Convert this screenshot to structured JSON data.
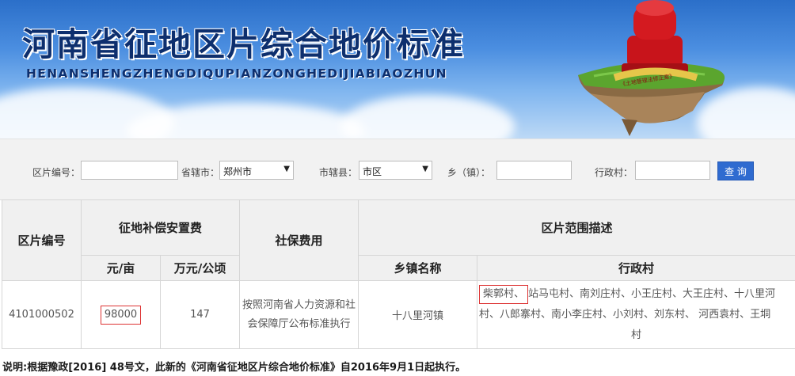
{
  "banner": {
    "title": "河南省征地区片综合地价标准",
    "subtitle": "HENANSHENGZHENGDIQUPIANZONGHEDIJIABIAOZHUN",
    "badge": "《土地管理法修正案》"
  },
  "search": {
    "zone_code_label": "区片编号：",
    "zone_code_value": "",
    "city_label": "省辖市：",
    "city_value": "郑州市",
    "county_label": "市辖县：",
    "county_value": "市区",
    "town_label": "乡（镇）：",
    "town_value": "",
    "village_label": "行政村：",
    "village_value": "",
    "query_button": "查 询"
  },
  "table": {
    "headers": {
      "zone_code": "区片编号",
      "compensation": "征地补偿安置费",
      "social_security": "社保费用",
      "range": "区片范围描述",
      "yuan_mu": "元/亩",
      "wan_qing": "万元/公顷",
      "town_name": "乡镇名称",
      "village": "行政村"
    },
    "rows": [
      {
        "zone_code": "4101000502",
        "yuan_mu": "98000",
        "wan_qing": "147",
        "social_security": "按照河南省人力资源和社会保障厅公布标准执行",
        "town_name": "十八里河镇",
        "village_highlight": "柴郭村、",
        "village_rest": "站马屯村、南刘庄村、小王庄村、大王庄村、十八里河村、八郎寨村、南小李庄村、小刘村、刘东村、 河西袁村、王垌",
        "village_last": "村"
      }
    ]
  },
  "note": "说明:根据豫政[2016] 48号文，此新的《河南省征地区片综合地价标准》自2016年9月1日起执行。",
  "colors": {
    "title": "#0d2f6e",
    "button": "#2f6bd0",
    "highlight_border": "#dd3333"
  }
}
